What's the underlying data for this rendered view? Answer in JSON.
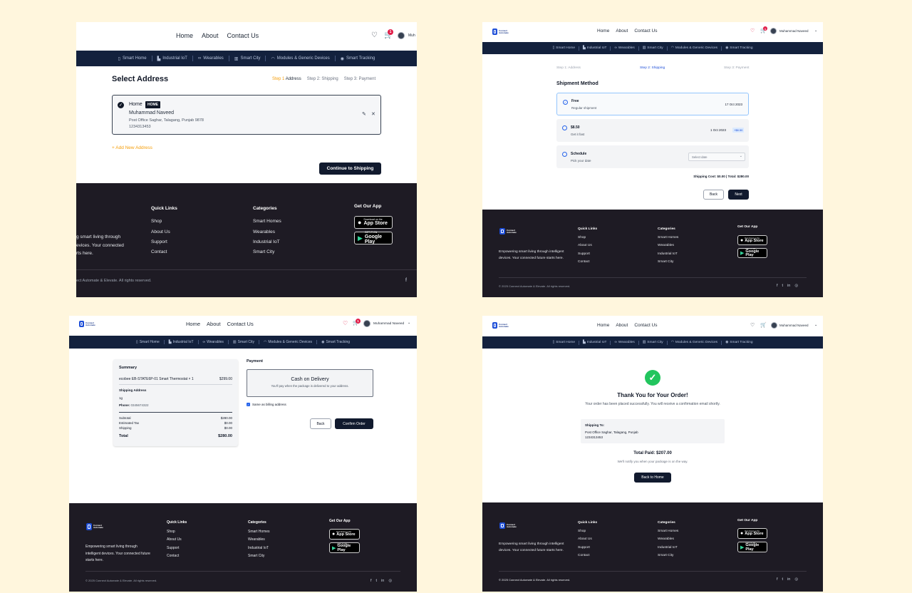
{
  "nav": {
    "home": "Home",
    "about": "About",
    "contact": "Contact Us",
    "user": "Muhammad Naveed",
    "user_short": "Muh",
    "cart_count": "1"
  },
  "categories": [
    "Smart Home",
    "Industrial IoT",
    "Wearables",
    "Smart City",
    "Modules & Generic Devices",
    "Smart Tracking"
  ],
  "footer": {
    "logo_line1": "Connect",
    "logo_line2": "Automate",
    "tagline": "Empowering smart living through intelligent devices. Your connected future starts here.",
    "tagline_cut_1": "g smart living through",
    "tagline_cut_2": "evices. Your connected",
    "tagline_cut_3": "rts here.",
    "quick_links_title": "Quick Links",
    "quick_links": [
      "Shop",
      "About Us",
      "Support",
      "Contact"
    ],
    "categories_title": "Categories",
    "categories": [
      "Smart Homes",
      "Wearables",
      "Industrial IoT",
      "Smart City"
    ],
    "app_title": "Get Our App",
    "appstore_small": "Download on the",
    "appstore_big": "App Store",
    "play_small": "GET IT ON",
    "play_big": "Google Play",
    "copyright": "© 2025 Connect Automate & Elevate. All rights reserved.",
    "copyright_cut": "ect Automate & Elevate. All rights reserved."
  },
  "p1": {
    "title": "Select Address",
    "step1_num": "Step 1",
    "step1_label": "Address",
    "step2": "Step 2: Shipping",
    "step3": "Step 3: Payment",
    "addr_label": "Home",
    "addr_badge": "HOME",
    "addr_name": "Muhammad Naveed",
    "addr_line": "Post Office Saghar, Talagang, Punjab 9878",
    "addr_phone": "1234313453",
    "add_new": "+ Add New Address",
    "continue": "Continue to Shipping"
  },
  "p2": {
    "step1": "Step 1: Address",
    "step2": "Step 2: Shipping",
    "step3": "Step 3: Payment",
    "title": "Shipment Method",
    "options": [
      {
        "name": "Free",
        "sub": "Regular shipment",
        "date": "17 Oct 2023",
        "extra": ""
      },
      {
        "name": "$8.50",
        "sub": "Get it fast",
        "date": "1 Oct 2023",
        "extra": "+$8.50"
      },
      {
        "name": "Schedule",
        "sub": "Pick your date",
        "date": "",
        "extra": ""
      }
    ],
    "select_placeholder": "Select date",
    "summary": "Shipping Cost: $0.00 | Total: $280.00",
    "back": "Back",
    "next": "Next"
  },
  "p3": {
    "summary_title": "Summary",
    "item": "ecobee EB-STATE6P-01 Smart Thermostat × 1",
    "item_price": "$299.00",
    "ship_addr_label": "Shipping Address",
    "ship_addr_val": "1g",
    "phone_label": "Phone:",
    "phone_val": "0345674322",
    "rows": [
      {
        "k": "Subtotal",
        "v": "$280.00"
      },
      {
        "k": "Estimated Tax",
        "v": "$0.00"
      },
      {
        "k": "Shipping",
        "v": "$0.00"
      }
    ],
    "total_k": "Total",
    "total_v": "$280.00",
    "payment_title": "Payment",
    "cod": "Cash on Delivery",
    "cod_sub": "You'll pay when the package is delivered to your address.",
    "billing": "Same as billing address",
    "back": "Back",
    "confirm": "Confirm Order"
  },
  "p4": {
    "title": "Thank You for Your Order!",
    "msg": "Your order has been placed successfully. You will receive a confirmation email shortly.",
    "ship_to": "Shipping To:",
    "addr": "Post Office Saghar, Talagang, Punjab",
    "phone": "1234313453",
    "total": "Total Paid: $207.00",
    "notify": "We'll notify you when your package is on the way.",
    "back": "Back to Home"
  }
}
